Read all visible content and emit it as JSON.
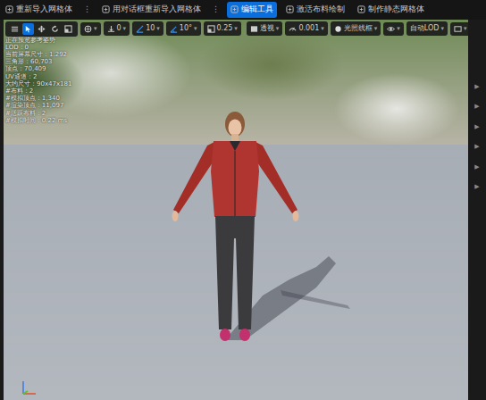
{
  "topbar": {
    "items": [
      {
        "label": "重新导入网格体",
        "selected": false,
        "more": "⋮"
      },
      {
        "label": "用对话框重新导入网格体",
        "selected": false,
        "more": "⋮"
      },
      {
        "label": "编辑工具",
        "selected": true
      },
      {
        "label": "激活布料绘制",
        "selected": false
      },
      {
        "label": "制作静态网格体",
        "selected": false
      }
    ]
  },
  "viewport_toolbar": {
    "tools": [
      {
        "kind": "menu",
        "selected": false
      },
      {
        "kind": "select",
        "selected": true
      },
      {
        "kind": "move",
        "selected": false
      },
      {
        "kind": "rotate",
        "selected": false
      },
      {
        "kind": "scale",
        "selected": false
      }
    ],
    "left": [
      {
        "kind": "world",
        "caret": "▾"
      },
      {
        "kind": "surface",
        "label": "0",
        "caret": "▾"
      },
      {
        "kind": "grid",
        "label": "10",
        "caret": "▾"
      },
      {
        "kind": "angle",
        "label": "10°",
        "caret": "▾"
      },
      {
        "kind": "scale",
        "label": "0.25",
        "caret": "▾"
      }
    ],
    "right": [
      {
        "kind": "view",
        "label": "透视",
        "caret": "▾"
      },
      {
        "kind": "speed",
        "label": "0.001",
        "caret": "▾"
      },
      {
        "kind": "lit",
        "label": "光照线框",
        "caret": "▾"
      },
      {
        "kind": "show",
        "caret": "▾"
      },
      {
        "kind": "lod",
        "label": "自动LOD",
        "caret": "▾"
      },
      {
        "kind": "screen",
        "caret": "▾"
      }
    ]
  },
  "stats": [
    "正在预览参考姿势",
    "LOD：0",
    "当前屏幕尺寸：1.292",
    "三角形：60,703",
    "顶点：70,409",
    "UV通道：2",
    "大约尺寸：90x47x181",
    "#布料：2",
    "#模拟顶点：1,340",
    "#渲染顶点：11,097",
    "#活跃布料：2",
    "#模拟时间：0.22 ms"
  ],
  "right_panel": {
    "arrows": [
      "▶",
      "▶",
      "▶",
      "▶",
      "▶",
      "▶"
    ]
  }
}
